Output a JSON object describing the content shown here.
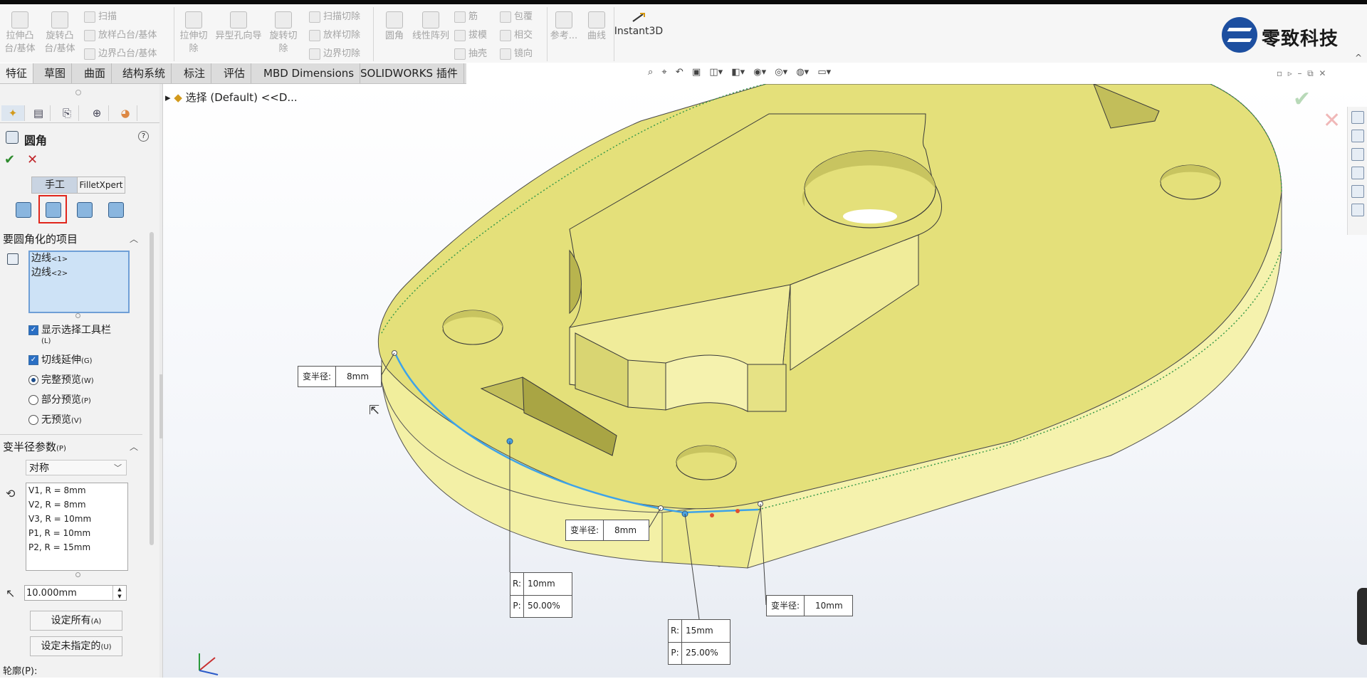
{
  "ribbon": {
    "extrude_boss": "拉伸凸台/基体",
    "revolve_boss": "旋转凸台/基体",
    "sweep": "扫描",
    "loft_boss": "放样凸台/基体",
    "boundary_boss": "边界凸台/基体",
    "extrude_cut": "拉伸切除",
    "hole_wizard": "异型孔向导",
    "revolve_cut": "旋转切除",
    "sweep_cut": "扫描切除",
    "loft_cut": "放样切除",
    "boundary_cut": "边界切除",
    "fillet": "圆角",
    "linear_pattern": "线性阵列",
    "rib": "筋",
    "draft": "拔模",
    "shell": "抽壳",
    "wrap": "包覆",
    "intersect": "相交",
    "mirror": "镜向",
    "reference": "参考...",
    "curves": "曲线",
    "instant3d": "Instant3D"
  },
  "logo": {
    "text": "零致科技",
    "up_arrow": "^"
  },
  "tabs": [
    "特征",
    "草图",
    "曲面",
    "结构系统",
    "标注",
    "评估",
    "MBD Dimensions",
    "SOLIDWORKS 插件"
  ],
  "tree": {
    "label": "选择 (Default) <<D..."
  },
  "feature": {
    "title": "圆角",
    "help": "?",
    "ok": "✔",
    "cancel": "✕",
    "mode_manual": "手工",
    "mode_xpert": "FilletXpert"
  },
  "items_section": {
    "title": "要圆角化的项目",
    "edges": [
      {
        "name": "边线",
        "idx": "<1>"
      },
      {
        "name": "边线",
        "idx": "<2>"
      }
    ]
  },
  "options": {
    "show_toolbar": "显示选择工具栏",
    "show_toolbar_key": "(L)",
    "tangent": "切线延伸",
    "tangent_key": "(G)",
    "full_preview": "完整预览",
    "full_preview_key": "(W)",
    "partial_preview": "部分预览",
    "partial_preview_key": "(P)",
    "no_preview": "无预览",
    "no_preview_key": "(V)"
  },
  "params": {
    "title": "变半径参数",
    "title_key": "(P)",
    "mode": "对称",
    "list": [
      "V1, R = 8mm",
      "V2, R = 8mm",
      "V3, R = 10mm",
      "P1, R = 10mm",
      "P2, R = 15mm"
    ],
    "radius": "10.000mm",
    "set_all": "设定所有",
    "set_all_key": "(A)",
    "set_unassigned": "设定未指定的",
    "set_unassigned_key": "(U)",
    "profile": "轮廓(P):"
  },
  "callouts": {
    "c1": {
      "label": "变半径:",
      "value": "8mm"
    },
    "c2": {
      "label": "变半径:",
      "value": "8mm"
    },
    "c3": {
      "label": "变半径:",
      "value": "10mm"
    },
    "c4": {
      "r_key": "R:",
      "r_val": "10mm",
      "p_key": "P:",
      "p_val": "50.00%"
    },
    "c5": {
      "r_key": "R:",
      "r_val": "15mm",
      "p_key": "P:",
      "p_val": "25.00%"
    }
  },
  "colors": {
    "part": "#e6e27a",
    "part_side": "#f1ee9c",
    "edge_highlight": "#3ea3e8"
  }
}
